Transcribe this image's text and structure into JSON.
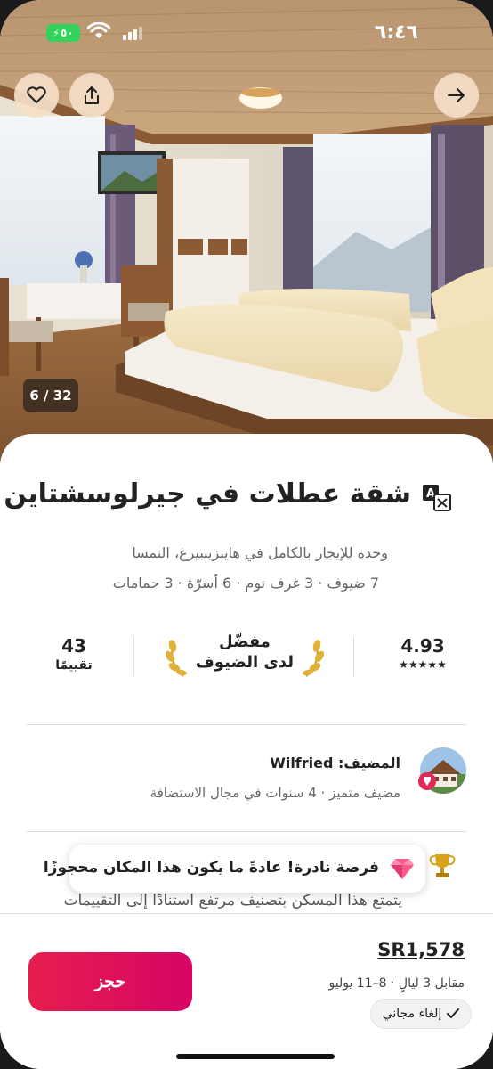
{
  "status_bar": {
    "time": "٦:٤٦",
    "battery_label": "٥٠"
  },
  "gallery": {
    "counter": "6 / 32"
  },
  "listing": {
    "title": "شقة عطلات في جيرلوسشتاين",
    "subtitle": "وحدة للإيجار بالكامل في هاينزينبيرغ، النمسا",
    "details": "7 ضيوف · 3 غرف نوم · 6 أسرّة · 3 حمامات"
  },
  "stats": {
    "rating": "4.93",
    "stars": "★★★★★",
    "star_count": 5,
    "guest_favorite_line1": "مفضّل",
    "guest_favorite_line2": "لدى الضيوف",
    "reviews_count": "43",
    "reviews_label": "تقييمًا"
  },
  "host": {
    "name_line": "المضيف: Wilfried",
    "meta": "مضيف متميز · 4 سنوات في مجال الاستضافة"
  },
  "highlight": {
    "rare_find": "فرصة نادرة! عادةً ما يكون هذا المكان محجوزًا",
    "description": "يتمتع هذا المسكن بتصنيف مرتفع استنادًا إلى التقييمات"
  },
  "booking": {
    "price": "SR1,578",
    "stay_info": "مقابل 3 ليالٍ · 8–11 يوليو",
    "free_cancellation": "إلغاء مجاني",
    "book_label": "حجز"
  },
  "colors": {
    "brand": "#E61E4D",
    "superhost_badge": "#E0285A",
    "battery": "#33D35B"
  },
  "icons": [
    "heart-icon",
    "share-icon",
    "arrow-right-icon",
    "translate-icon",
    "laurel-icon",
    "diamond-icon",
    "trophy-icon",
    "check-icon",
    "wifi-icon",
    "signal-icon"
  ]
}
